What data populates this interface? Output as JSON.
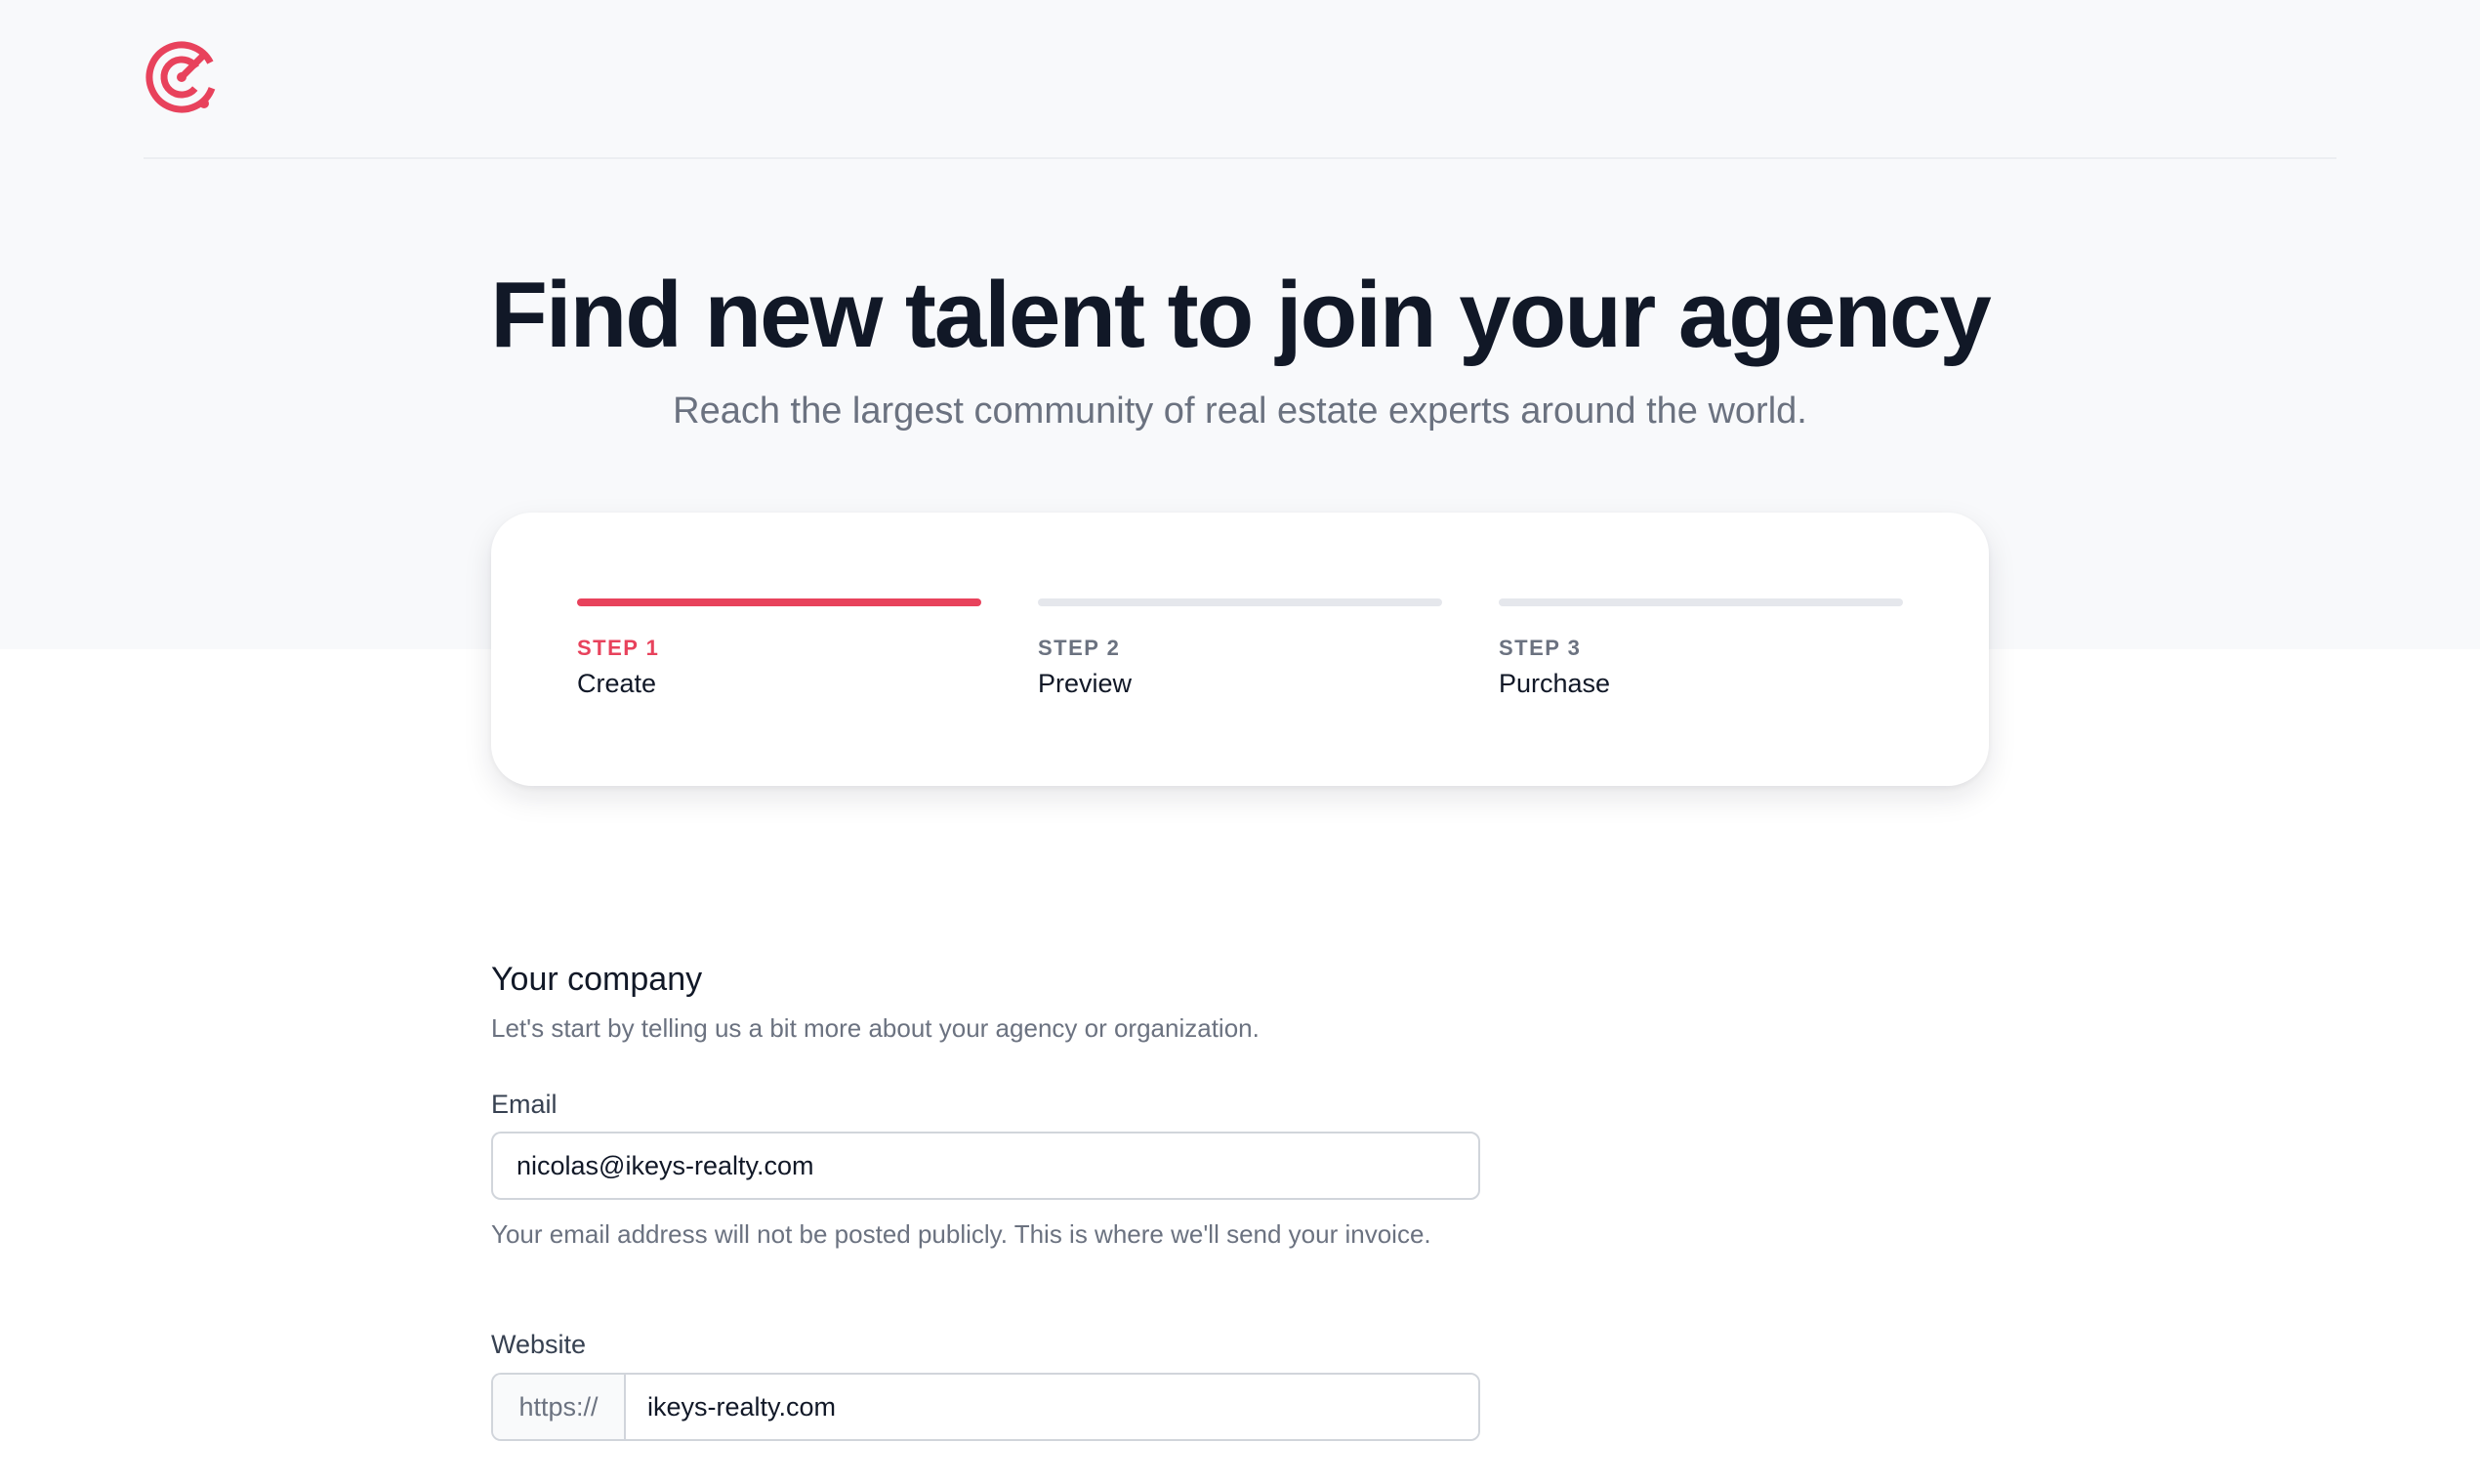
{
  "brand": {
    "logo_icon": "target-icon",
    "accent_color": "#e8425c"
  },
  "hero": {
    "title": "Find new talent to join your agency",
    "subtitle": "Reach the largest community of real estate experts around the world."
  },
  "steps": [
    {
      "number": "STEP 1",
      "name": "Create",
      "status": "current"
    },
    {
      "number": "STEP 2",
      "name": "Preview",
      "status": "upcoming"
    },
    {
      "number": "STEP 3",
      "name": "Purchase",
      "status": "upcoming"
    }
  ],
  "company_section": {
    "title": "Your company",
    "description": "Let's start by telling us a bit more about your agency or organization."
  },
  "email_field": {
    "label": "Email",
    "value": "nicolas@ikeys-realty.com",
    "help": "Your email address will not be posted publicly. This is where we'll send your invoice."
  },
  "website_field": {
    "label": "Website",
    "prefix": "https://",
    "value": "ikeys-realty.com"
  }
}
